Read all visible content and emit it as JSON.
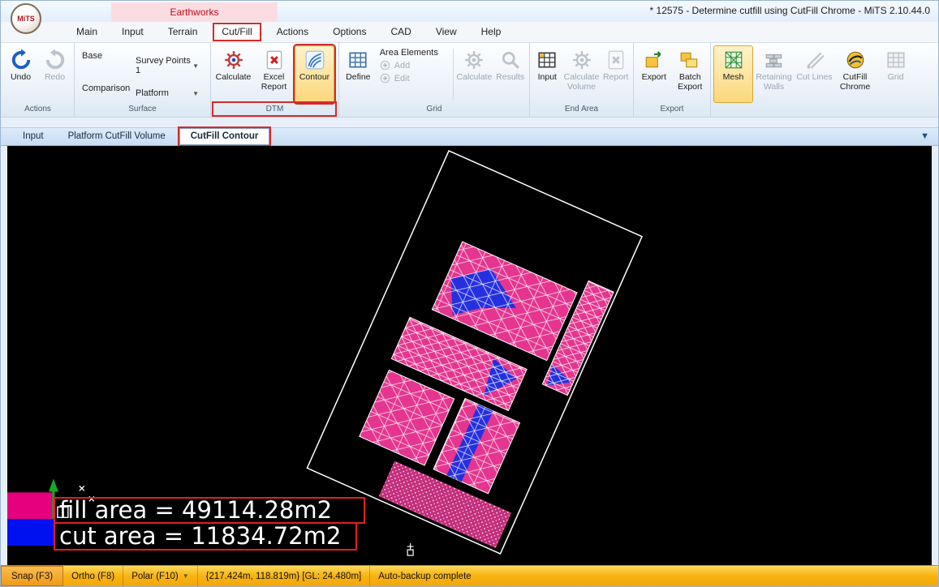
{
  "window": {
    "title": "* 12575 - Determine cutfill using CutFill Chrome - MiTS 2.10.44.0",
    "logo_text": "MiTS"
  },
  "contextual_group": {
    "label": "Earthworks"
  },
  "menu_tabs": [
    {
      "label": "Main"
    },
    {
      "label": "Input"
    },
    {
      "label": "Terrain"
    },
    {
      "label": "Cut/Fill",
      "selected": true
    },
    {
      "label": "Actions"
    },
    {
      "label": "Options"
    },
    {
      "label": "CAD"
    },
    {
      "label": "View"
    },
    {
      "label": "Help"
    }
  ],
  "ribbon": {
    "actions": {
      "label": "Actions",
      "undo": "Undo",
      "redo": "Redo"
    },
    "surface": {
      "label": "Surface",
      "base_label": "Base",
      "base_value": "Survey Points 1",
      "comparison_label": "Comparison",
      "comparison_value": "Platform"
    },
    "dtm": {
      "label": "DTM",
      "calculate": "Calculate",
      "excel_report": "Excel Report",
      "contour": "Contour"
    },
    "grid": {
      "label": "Grid",
      "define": "Define",
      "area_elements": "Area Elements",
      "add": "Add",
      "edit": "Edit",
      "calculate": "Calculate",
      "results": "Results"
    },
    "end_area": {
      "label": "End Area",
      "input": "Input",
      "calculate_volume": "Calculate Volume",
      "report": "Report"
    },
    "export": {
      "label": "Export",
      "export": "Export",
      "batch_export": "Batch Export"
    },
    "tools": {
      "mesh": "Mesh",
      "retaining_walls": "Retaining Walls",
      "cut_lines": "Cut Lines",
      "cutfill_chrome": "CutFill Chrome",
      "grid": "Grid"
    }
  },
  "document_tabs": [
    {
      "label": "Input"
    },
    {
      "label": "Platform CutFill Volume"
    },
    {
      "label": "CutFill Contour",
      "active": true
    }
  ],
  "canvas": {
    "fill_area_text": "fill area = 49114.28m2",
    "cut_area_text": "cut area = 11834.72m2"
  },
  "status_bar": {
    "snap": "Snap (F3)",
    "ortho": "Ortho (F8)",
    "polar": "Polar (F10)",
    "coordinates": "{217.424m, 118.819m} [GL: 24.480m]",
    "message": "Auto-backup complete"
  },
  "colors": {
    "annotation_red": "#d62a2a",
    "mesh_pink": "#e5358f",
    "mesh_blue": "#2430e0",
    "fill_swatch_magenta": "#e6007e",
    "cut_swatch_blue": "#0011ef",
    "status_yellow": "#f9b410",
    "highlight_orange": "#fcd77c"
  }
}
